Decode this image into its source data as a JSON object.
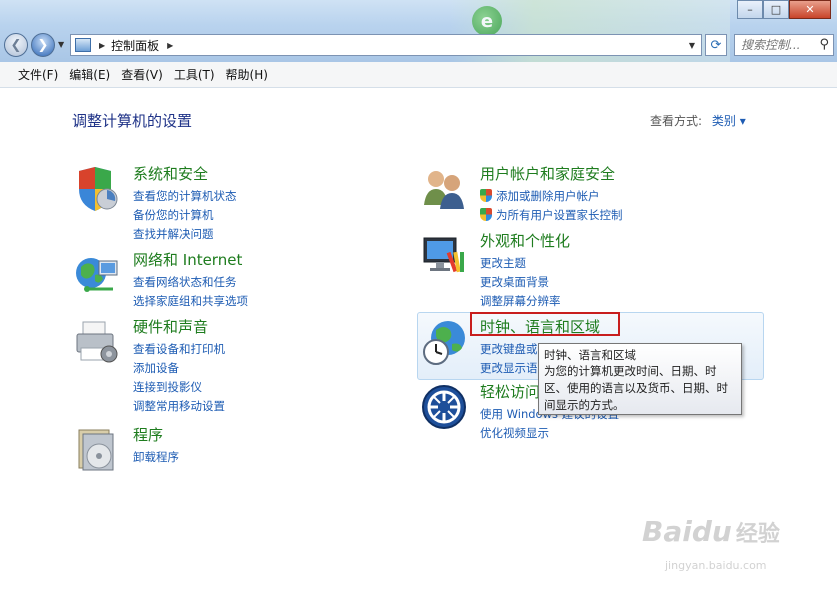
{
  "toolbar": {
    "breadcrumb": "控制面板",
    "search_placeholder": "搜索控制..."
  },
  "menu": [
    "文件(F)",
    "编辑(E)",
    "查看(V)",
    "工具(T)",
    "帮助(H)"
  ],
  "main": {
    "heading": "调整计算机的设置",
    "view_by_label": "查看方式:",
    "view_by_value": "类别"
  },
  "categories": [
    {
      "title": "系统和安全",
      "icon": "security-shield-icon",
      "links": [
        "查看您的计算机状态",
        "备份您的计算机",
        "查找并解决问题"
      ]
    },
    {
      "title": "网络和 Internet",
      "icon": "network-globe-icon",
      "links": [
        "查看网络状态和任务",
        "选择家庭组和共享选项"
      ]
    },
    {
      "title": "硬件和声音",
      "icon": "printer-icon",
      "links": [
        "查看设备和打印机",
        "添加设备",
        "连接到投影仪",
        "调整常用移动设置"
      ]
    },
    {
      "title": "程序",
      "icon": "programs-disc-icon",
      "links": [
        "卸载程序"
      ]
    },
    {
      "title": "用户帐户和家庭安全",
      "icon": "users-icon",
      "links": [
        "添加或删除用户帐户",
        "为所有用户设置家长控制"
      ]
    },
    {
      "title": "外观和个性化",
      "icon": "monitor-palette-icon",
      "links": [
        "更改主题",
        "更改桌面背景",
        "调整屏幕分辨率"
      ]
    },
    {
      "title": "时钟、语言和区域",
      "icon": "globe-clock-icon",
      "links": [
        "更改键盘或其他输入法",
        "更改显示语"
      ]
    },
    {
      "title": "轻松访问",
      "icon": "ease-of-access-icon",
      "links": [
        "使用 Windows 建议的设置",
        "优化视频显示"
      ]
    }
  ],
  "tooltip": {
    "title": "时钟、语言和区域",
    "lines": [
      "为您的计算机更改时间、日期、时",
      "区、使用的语言以及货币、日期、时",
      "间显示的方式。"
    ]
  },
  "watermark": {
    "text": "Baidu",
    "suffix": "经验",
    "url": "jingyan.baidu.com"
  }
}
